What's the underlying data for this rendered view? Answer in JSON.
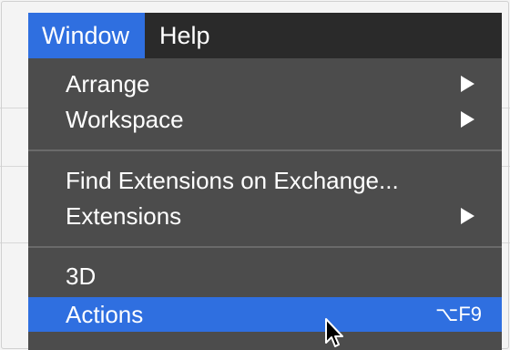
{
  "menubar": {
    "items": [
      {
        "label": "Window",
        "active": true
      },
      {
        "label": "Help",
        "active": false
      }
    ]
  },
  "menu": {
    "items": [
      {
        "label": "Arrange",
        "submenu": true
      },
      {
        "label": "Workspace",
        "submenu": true
      },
      {
        "label": "Find Extensions on Exchange...",
        "submenu": false
      },
      {
        "label": "Extensions",
        "submenu": true
      },
      {
        "label": "3D",
        "submenu": false
      },
      {
        "label": "Actions",
        "shortcut": "⌥F9",
        "highlighted": true
      }
    ]
  },
  "colors": {
    "menubar_bg": "#2a2a2a",
    "menu_bg": "#4c4c4c",
    "highlight": "#2f6fe0",
    "text": "#ffffff"
  },
  "icons": {
    "submenu": "triangle-right-icon",
    "cursor": "mouse-pointer-icon"
  }
}
